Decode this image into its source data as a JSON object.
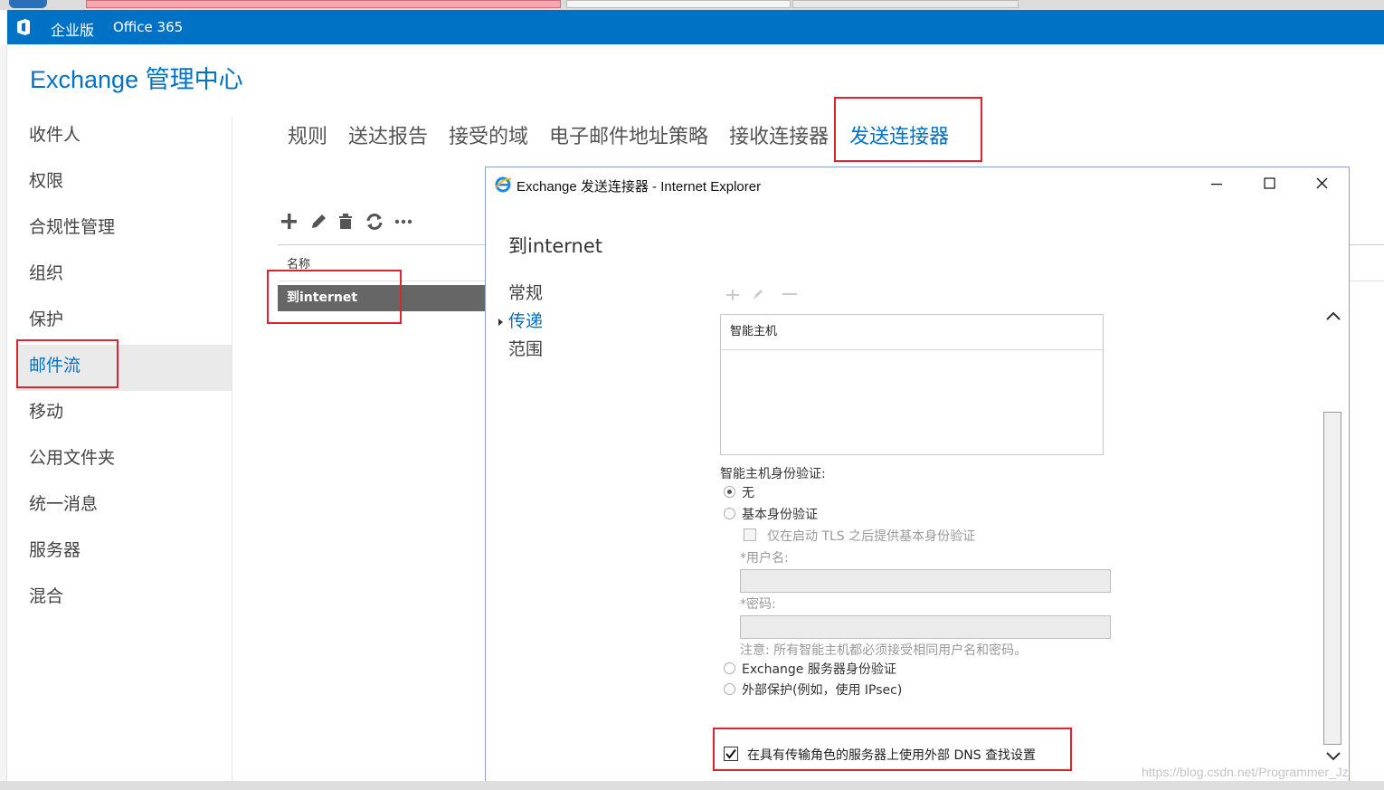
{
  "topbar": {
    "edition": "企业版",
    "product": "Office 365"
  },
  "page": {
    "title": "Exchange 管理中心"
  },
  "leftnav": {
    "items": [
      "收件人",
      "权限",
      "合规性管理",
      "组织",
      "保护",
      "邮件流",
      "移动",
      "公用文件夹",
      "统一消息",
      "服务器",
      "混合"
    ],
    "active": "邮件流"
  },
  "subnav": {
    "tabs": [
      "规则",
      "送达报告",
      "接受的域",
      "电子邮件地址策略",
      "接收连接器",
      "发送连接器"
    ],
    "active": "发送连接器"
  },
  "list": {
    "column_name": "名称",
    "selected_row": "到internet"
  },
  "dialog": {
    "window_title": "Exchange 发送连接器 - Internet Explorer",
    "heading": "到internet",
    "nav": [
      "常规",
      "传递",
      "范围"
    ],
    "nav_active": "传递",
    "smarthost_header": "智能主机",
    "auth_label": "智能主机身份验证:",
    "opt_none": "无",
    "opt_basic": "基本身份验证",
    "opt_basic_tls": "仅在启动 TLS 之后提供基本身份验证",
    "username_label": "*用户名:",
    "password_label": "*密码:",
    "note": "注意: 所有智能主机都必须接受相同用户名和密码。",
    "opt_exchange": "Exchange 服务器身份验证",
    "opt_external": "外部保护(例如，使用 IPsec)",
    "dns_setting": "在具有传输角色的服务器上使用外部 DNS 查找设置"
  },
  "watermark": "https://blog.csdn.net/Programmer_Jz",
  "colors": {
    "brand": "#0072c6",
    "highlight": "#e0212e",
    "selected_row": "#666666"
  }
}
